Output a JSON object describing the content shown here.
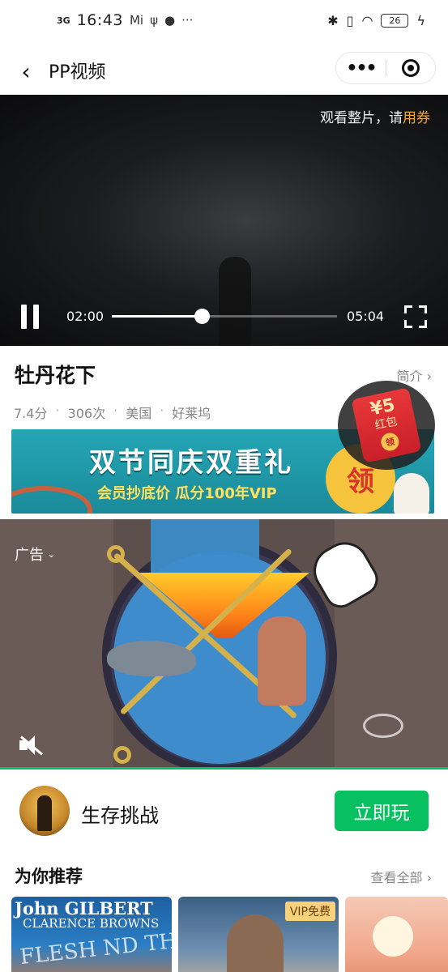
{
  "status_bar": {
    "network": "3G",
    "time": "16:43",
    "notif_badge": "Mi",
    "usb_icon": "usb-icon",
    "chat_icon": "chat-bubble-icon",
    "more": "···",
    "battery": "26"
  },
  "nav": {
    "title": "PP视频",
    "back_icon": "chevron-left-icon",
    "more_icon": "more-dots-icon",
    "close_icon": "target-close-icon"
  },
  "player": {
    "coupon_tip_prefix": "观看整片，请",
    "coupon_tip_link": "用券",
    "current_time": "02:00",
    "total_time": "05:04",
    "progress": 0.4,
    "playing": true
  },
  "movie": {
    "title": "牡丹花下",
    "intro_link": "简介",
    "rating": "7.4分",
    "plays": "306次",
    "country": "美国",
    "studio": "好莱坞"
  },
  "red_packet": {
    "amount": "¥5",
    "label": "红包",
    "seal": "领"
  },
  "banner": {
    "headline": "双节同庆双重礼",
    "subline": "会员抄底价  瓜分100年VIP",
    "coin": "领"
  },
  "ad": {
    "label": "广告",
    "game_name": "生存挑战",
    "play_button": "立即玩"
  },
  "recommend": {
    "title": "为你推荐",
    "more": "查看全部",
    "posters": [
      {
        "line1": "John GILBERT",
        "line2": "CLARENCE BROWNS",
        "line3": "FLESH ND THE DEVIL"
      },
      {
        "badge": "VIP免费"
      },
      {}
    ]
  },
  "colors": {
    "accent_green": "#07c160",
    "coupon_orange": "#f4a640",
    "banner_teal": "#25a6b5"
  }
}
